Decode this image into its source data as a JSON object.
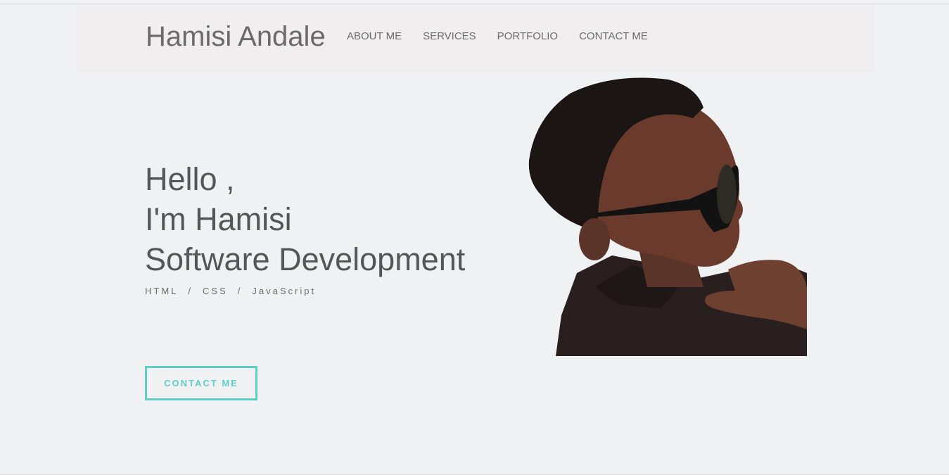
{
  "brand": {
    "name": "Hamisi Andale"
  },
  "nav": {
    "items": [
      {
        "label": "ABOUT ME"
      },
      {
        "label": "SERVICES"
      },
      {
        "label": "PORTFOLIO"
      },
      {
        "label": "CONTACT ME"
      }
    ]
  },
  "hero": {
    "line1": "Hello ,",
    "line2": "I'm Hamisi",
    "line3": "Software Development",
    "skills": [
      "HTML",
      "CSS",
      "JavaScript"
    ],
    "separator": "/",
    "cta_label": "CONTACT ME"
  },
  "colors": {
    "accent": "#5fcfc5",
    "text": "#565656",
    "background": "#f0f1f3",
    "navbar": "#f0eeee"
  }
}
